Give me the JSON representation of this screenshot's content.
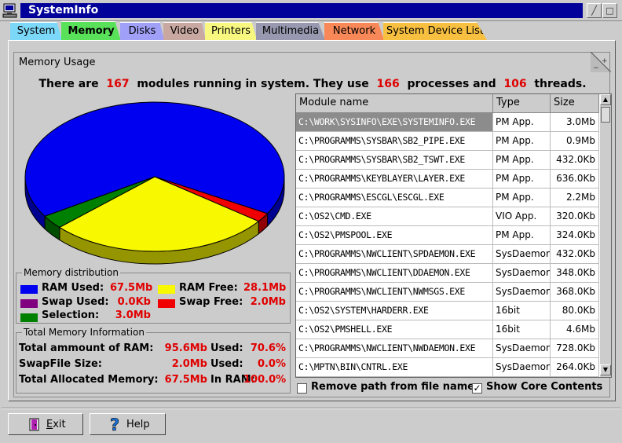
{
  "window": {
    "title": "SystemInfo"
  },
  "tabs": [
    {
      "label": "System",
      "color": "#7cd8f8"
    },
    {
      "label": "Memory",
      "color": "#5ae15a",
      "active": true
    },
    {
      "label": "Disks",
      "color": "#a0a0f8"
    },
    {
      "label": "Video",
      "color": "#c8a8a0"
    },
    {
      "label": "Printers",
      "color": "#f8f880"
    },
    {
      "label": "Multimedia",
      "color": "#9898b0"
    },
    {
      "label": "Network",
      "color": "#f88858"
    },
    {
      "label": "System Device List",
      "color": "#f8c040"
    }
  ],
  "group_title": "Memory Usage",
  "summary": {
    "p1": "There are",
    "modules": "167",
    "p2": "modules running in system. They use",
    "processes": "166",
    "p3": "processes and",
    "threads": "106",
    "p4": "threads."
  },
  "pie": {
    "slices": [
      {
        "name": "RAM Used",
        "value": 67.5,
        "color": "#0000f0"
      },
      {
        "name": "Swap Free",
        "value": 2.0,
        "color": "#f00000"
      },
      {
        "name": "RAM Free",
        "value": 28.1,
        "color": "#f8f800"
      },
      {
        "name": "Selection",
        "value": 3.0,
        "color": "#008000"
      }
    ]
  },
  "distribution": {
    "title": "Memory distribution",
    "ram_used_label": "RAM Used:",
    "ram_used": "67.5Mb",
    "ram_free_label": "RAM Free:",
    "ram_free": "28.1Mb",
    "swap_used_label": "Swap Used:",
    "swap_used": "0.0Kb",
    "swap_free_label": "Swap Free:",
    "swap_free": "2.0Mb",
    "selection_label": "Selection:",
    "selection": "3.0Mb",
    "colors": {
      "ram_used": "#0000f0",
      "ram_free": "#f8f800",
      "swap_used": "#800080",
      "swap_free": "#f00000",
      "selection": "#008000"
    }
  },
  "total": {
    "title": "Total Memory Information",
    "rows": [
      {
        "label": "Total ammount of RAM:",
        "value": "95.6Mb",
        "label2": "Used:",
        "value2": "70.6%"
      },
      {
        "label": "SwapFile Size:",
        "value": "2.0Mb",
        "label2": "Used:",
        "value2": "0.0%"
      },
      {
        "label": "Total Allocated Memory:",
        "value": "67.5Mb",
        "label2": "In RAM:",
        "value2": "100.0%"
      }
    ]
  },
  "table": {
    "headers": [
      "Module name",
      "Type",
      "Size"
    ],
    "rows": [
      [
        "C:\\WORK\\SYSINFO\\EXE\\SYSTEMINFO.EXE",
        "PM App.",
        "3.0Mb"
      ],
      [
        "C:\\PROGRAMMS\\SYSBAR\\SB2_PIPE.EXE",
        "PM App.",
        "0.9Mb"
      ],
      [
        "C:\\PROGRAMMS\\SYSBAR\\SB2_TSWT.EXE",
        "PM App.",
        "432.0Kb"
      ],
      [
        "C:\\PROGRAMMS\\KEYBLAYER\\LAYER.EXE",
        "PM App.",
        "636.0Kb"
      ],
      [
        "C:\\PROGRAMMS\\ESCGL\\ESCGL.EXE",
        "PM App.",
        "2.2Mb"
      ],
      [
        "C:\\OS2\\CMD.EXE",
        "VIO App.",
        "320.0Kb"
      ],
      [
        "C:\\OS2\\PMSPOOL.EXE",
        "PM App.",
        "324.0Kb"
      ],
      [
        "C:\\PROGRAMMS\\NWCLIENT\\SPDAEMON.EXE",
        "SysDaemon",
        "432.0Kb"
      ],
      [
        "C:\\PROGRAMMS\\NWCLIENT\\DDAEMON.EXE",
        "SysDaemon",
        "348.0Kb"
      ],
      [
        "C:\\PROGRAMMS\\NWCLIENT\\NWMSGS.EXE",
        "SysDaemon",
        "368.0Kb"
      ],
      [
        "C:\\OS2\\SYSTEM\\HARDERR.EXE",
        "16bit",
        "80.0Kb"
      ],
      [
        "C:\\OS2\\PMSHELL.EXE",
        "16bit",
        "4.6Mb"
      ],
      [
        "C:\\PROGRAMMS\\NWCLIENT\\NWDAEMON.EXE",
        "SysDaemon",
        "728.0Kb"
      ],
      [
        "C:\\MPTN\\BIN\\CNTRL.EXE",
        "SysDaemon",
        "264.0Kb"
      ]
    ],
    "selected_row": 0
  },
  "options": {
    "remove_path_label": "Remove path from file names",
    "remove_path_checked": false,
    "show_core_label": "Show Core Contents",
    "show_core_checked": true,
    "check_mark": "✓"
  },
  "buttons": {
    "exit": "Exit",
    "exit_underline": "E",
    "help": "Help"
  }
}
